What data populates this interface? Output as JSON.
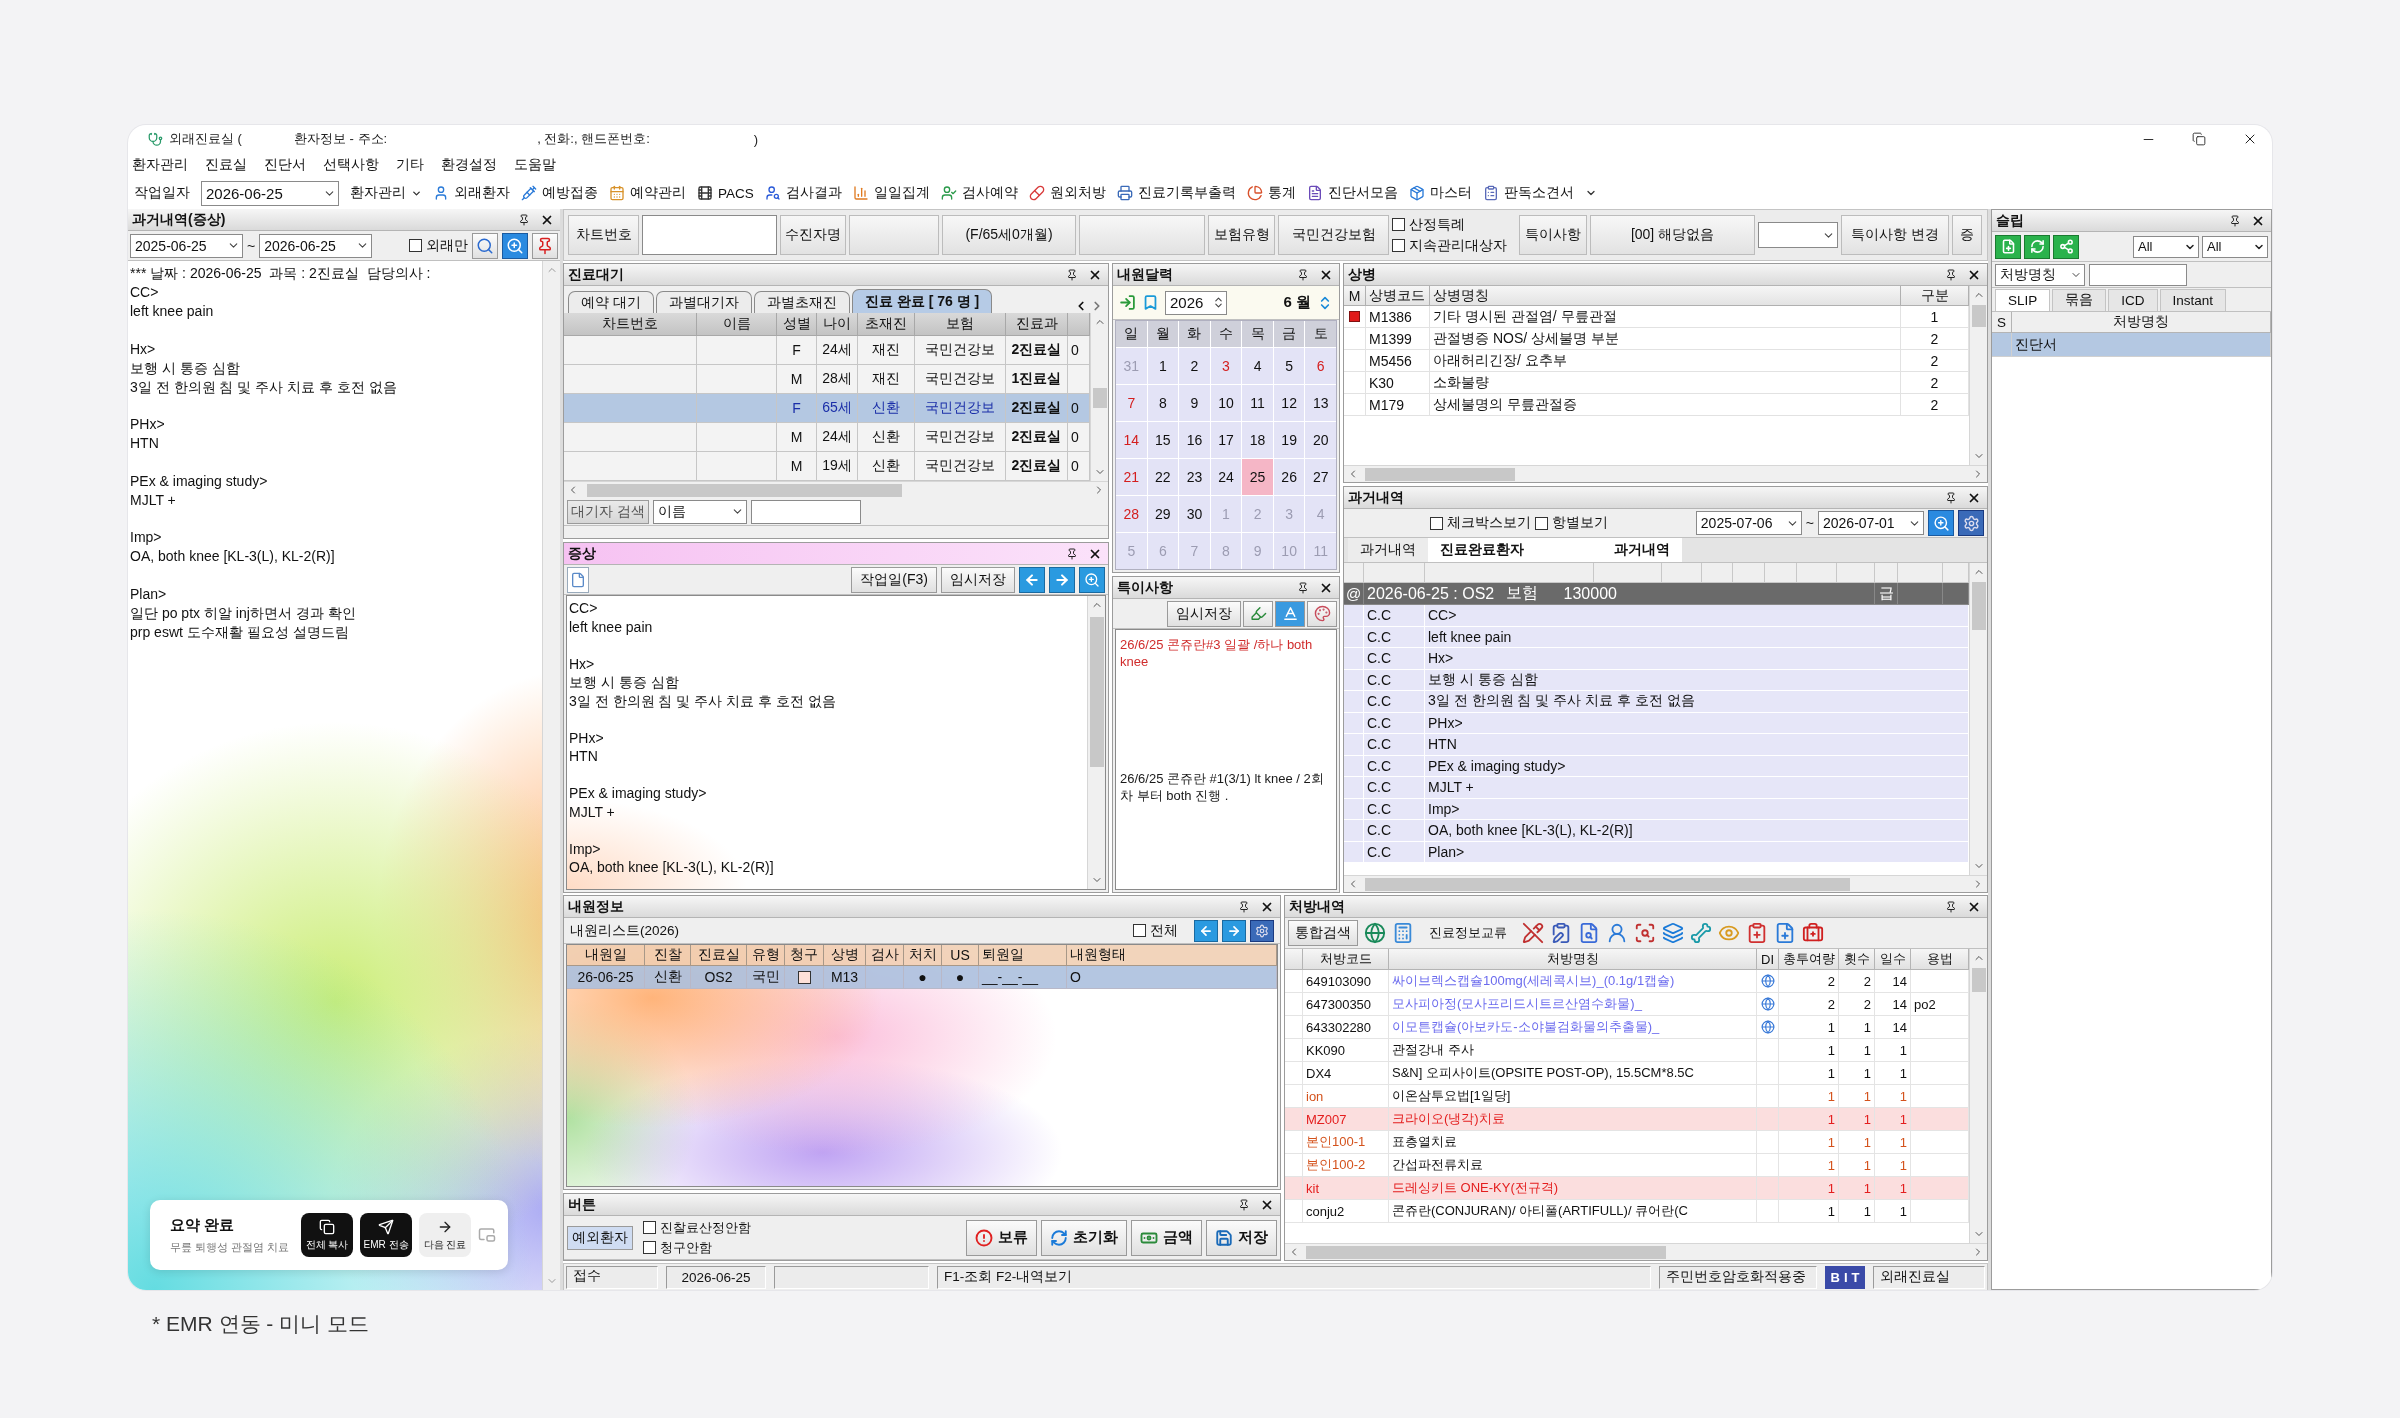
{
  "window": {
    "title_parts": [
      "외래진료실 (",
      "환자정보 - 주소:",
      ", 전화:, 핸드폰번호:",
      ")"
    ]
  },
  "menu": [
    "환자관리",
    "진료실",
    "진단서",
    "선택사항",
    "기타",
    "환경설정",
    "도움말"
  ],
  "toolbar": {
    "date_label": "작업일자",
    "date": "2026-06-25",
    "patient_menu": "환자관리",
    "buttons": [
      "외래환자",
      "예방접종",
      "예약관리",
      "PACS",
      "검사결과",
      "일일집계",
      "검사예약",
      "원외처방",
      "진료기록부출력",
      "통계",
      "진단서모음",
      "마스터",
      "판독소견서"
    ]
  },
  "history": {
    "title": "과거내역(증상)",
    "date_from": "2025-06-25",
    "separator": "~",
    "date_to": "2026-06-25",
    "outpatient_only": {
      "label": "외래만",
      "checked": false
    },
    "header_line": "*** 날짜 : 2026-06-25  과목 : 2진료실  담당의사 :",
    "blocks": [
      [
        "CC>",
        "left knee pain"
      ],
      [
        "Hx>",
        "보행 시 통증 심함",
        "3일 전 한의원 침 및 주사 치료 후 호전 없음"
      ],
      [
        "PHx>",
        "HTN"
      ],
      [
        "PEx & imaging study>",
        "MJLT +"
      ],
      [
        "Imp>",
        "OA, both knee [KL-3(L), KL-2(R)]"
      ],
      [
        "Plan>",
        "일단 po ptx 히알 inj하면서 경과 확인",
        "prp eswt 도수재활 필요성 설명드림"
      ]
    ]
  },
  "summary_card": {
    "title": "요약 완료",
    "subtitle": "무릎 퇴행성 관절염 치료",
    "actions": [
      {
        "label": "전체 복사",
        "kind": "dark"
      },
      {
        "label": "EMR 전송",
        "kind": "dark"
      },
      {
        "label": "다음 진료",
        "kind": "light"
      }
    ]
  },
  "patient_bar": {
    "chart_no_label": "차트번호",
    "name_label": "수진자명",
    "age": "(F/65세0개월)",
    "insurance_label": "보험유형",
    "insurance": "국민건강보험",
    "flags": [
      {
        "label": "산정특례",
        "checked": false
      },
      {
        "label": "지속관리대상자",
        "checked": false
      }
    ],
    "special_label": "특이사항",
    "special_value": "[00] 해당없음",
    "special_change": "특이사항 변경",
    "cut_button": "증"
  },
  "waiting": {
    "title": "진료대기",
    "tabs": [
      {
        "label": "예약 대기",
        "selected": false
      },
      {
        "label": "과별대기자",
        "selected": false
      },
      {
        "label": "과별초재진",
        "selected": false
      },
      {
        "label": "진료 완료 [ 76 명 ]",
        "selected": true
      }
    ],
    "columns": [
      "차트번호",
      "이름",
      "성별",
      "나이",
      "초재진",
      "보험",
      "진료과"
    ],
    "rows": [
      {
        "sex": "F",
        "age": "24세",
        "visit": "재진",
        "insurance": "국민건강보",
        "room": "2진료실",
        "column_8": "0",
        "selected": false
      },
      {
        "sex": "M",
        "age": "28세",
        "visit": "재진",
        "insurance": "국민건강보",
        "room": "1진료실",
        "selected": false
      },
      {
        "sex": "F",
        "age": "65세",
        "visit": "신환",
        "insurance": "국민건강보",
        "room": "2진료실",
        "column_8": "0",
        "selected": true
      },
      {
        "sex": "M",
        "age": "24세",
        "visit": "신환",
        "insurance": "국민건강보",
        "room": "2진료실",
        "column_8": "0",
        "selected": false
      },
      {
        "sex": "M",
        "age": "19세",
        "visit": "신환",
        "insurance": "국민건강보",
        "room": "2진료실",
        "column_8": "0",
        "selected": false
      }
    ],
    "search": {
      "label": "대기자 검색",
      "field": "이름"
    }
  },
  "symptoms": {
    "title": "증상",
    "buttons": [
      "작업일(F3)",
      "임시저장"
    ],
    "blocks": [
      [
        "CC>",
        "left knee pain"
      ],
      [
        "Hx>",
        "보행 시 통증 심함",
        "3일 전 한의원 침 및 주사 치료 후 호전 없음"
      ],
      [
        "PHx>",
        "HTN"
      ],
      [
        "PEx & imaging study>",
        "MJLT +"
      ],
      [
        "Imp>",
        "OA, both knee [KL-3(L), KL-2(R)]"
      ]
    ]
  },
  "calendar": {
    "title": "내원달력",
    "year": "2026",
    "month": "6 월",
    "weekdays": [
      "일",
      "월",
      "화",
      "수",
      "목",
      "금",
      "토"
    ],
    "weeks": [
      [
        {
          "day": "31",
          "in_month": false,
          "holiday": false,
          "selected": false
        },
        {
          "day": "1",
          "in_month": true,
          "holiday": false,
          "selected": false
        },
        {
          "day": "2",
          "in_month": true,
          "holiday": false,
          "selected": false
        },
        {
          "day": "3",
          "in_month": true,
          "holiday": true,
          "selected": false
        },
        {
          "day": "4",
          "in_month": true,
          "holiday": false,
          "selected": false
        },
        {
          "day": "5",
          "in_month": true,
          "holiday": false,
          "selected": false
        },
        {
          "day": "6",
          "in_month": true,
          "holiday": true,
          "selected": false
        }
      ],
      [
        {
          "day": "7",
          "in_month": true,
          "holiday": true,
          "selected": false
        },
        {
          "day": "8",
          "in_month": true,
          "holiday": false,
          "selected": false
        },
        {
          "day": "9",
          "in_month": true,
          "holiday": false,
          "selected": false
        },
        {
          "day": "10",
          "in_month": true,
          "holiday": false,
          "selected": false
        },
        {
          "day": "11",
          "in_month": true,
          "holiday": false,
          "selected": false
        },
        {
          "day": "12",
          "in_month": true,
          "holiday": false,
          "selected": false
        },
        {
          "day": "13",
          "in_month": true,
          "holiday": false,
          "selected": false
        }
      ],
      [
        {
          "day": "14",
          "in_month": true,
          "holiday": true,
          "selected": false
        },
        {
          "day": "15",
          "in_month": true,
          "holiday": false,
          "selected": false
        },
        {
          "day": "16",
          "in_month": true,
          "holiday": false,
          "selected": false
        },
        {
          "day": "17",
          "in_month": true,
          "holiday": false,
          "selected": false
        },
        {
          "day": "18",
          "in_month": true,
          "holiday": false,
          "selected": false
        },
        {
          "day": "19",
          "in_month": true,
          "holiday": false,
          "selected": false
        },
        {
          "day": "20",
          "in_month": true,
          "holiday": false,
          "selected": false
        }
      ],
      [
        {
          "day": "21",
          "in_month": true,
          "holiday": true,
          "selected": false
        },
        {
          "day": "22",
          "in_month": true,
          "holiday": false,
          "selected": false
        },
        {
          "day": "23",
          "in_month": true,
          "holiday": false,
          "selected": false
        },
        {
          "day": "24",
          "in_month": true,
          "holiday": false,
          "selected": false
        },
        {
          "day": "25",
          "in_month": true,
          "holiday": false,
          "selected": true
        },
        {
          "day": "26",
          "in_month": true,
          "holiday": false,
          "selected": false
        },
        {
          "day": "27",
          "in_month": true,
          "holiday": false,
          "selected": false
        }
      ],
      [
        {
          "day": "28",
          "in_month": true,
          "holiday": true,
          "selected": false
        },
        {
          "day": "29",
          "in_month": true,
          "holiday": false,
          "selected": false
        },
        {
          "day": "30",
          "in_month": true,
          "holiday": false,
          "selected": false
        },
        {
          "day": "1",
          "in_month": false,
          "holiday": false,
          "selected": false
        },
        {
          "day": "2",
          "in_month": false,
          "holiday": false,
          "selected": false
        },
        {
          "day": "3",
          "in_month": false,
          "holiday": false,
          "selected": false
        },
        {
          "day": "4",
          "in_month": false,
          "holiday": false,
          "selected": false
        }
      ],
      [
        {
          "day": "5",
          "in_month": false,
          "holiday": false,
          "selected": false
        },
        {
          "day": "6",
          "in_month": false,
          "holiday": false,
          "selected": false
        },
        {
          "day": "7",
          "in_month": false,
          "holiday": false,
          "selected": false
        },
        {
          "day": "8",
          "in_month": false,
          "holiday": false,
          "selected": false
        },
        {
          "day": "9",
          "in_month": false,
          "holiday": false,
          "selected": false
        },
        {
          "day": "10",
          "in_month": false,
          "holiday": false,
          "selected": false
        },
        {
          "day": "11",
          "in_month": false,
          "holiday": false,
          "selected": false
        }
      ]
    ]
  },
  "special_notes": {
    "title": "특이사항",
    "save": "임시저장",
    "notes": [
      {
        "text": "26/6/25 콘쥬란#3 일괄 /하나  both knee",
        "color": "#d02c2c"
      },
      {
        "text": "26/6/25 콘쥬란 #1(3/1) lt knee / 2회차 부터 both 진행 .",
        "color": "#1a1a1a"
      }
    ]
  },
  "diagnosis": {
    "title": "상병",
    "columns": [
      "M",
      "상병코드",
      "상병명칭",
      "구분"
    ],
    "rows": [
      {
        "code": "M1386",
        "name": "기타 명시된 관절염/ 무릎관절",
        "type": "1",
        "main": true
      },
      {
        "code": "M1399",
        "name": "관절병증 NOS/ 상세불명 부분",
        "type": "2",
        "main": false
      },
      {
        "code": "M5456",
        "name": "아래허리긴장/ 요추부",
        "type": "2",
        "main": false
      },
      {
        "code": "K30",
        "name": "소화불량",
        "type": "2",
        "main": false
      },
      {
        "code": "M179",
        "name": "상세불명의 무릎관절증",
        "type": "2",
        "main": false
      }
    ]
  },
  "past": {
    "title": "과거내역",
    "options": [
      {
        "label": "체크박스보기",
        "checked": false
      },
      {
        "label": "항별보기",
        "checked": false
      }
    ],
    "date_from": "2025-07-06",
    "separator": "~",
    "date_to": "2026-07-01",
    "tabs": [
      {
        "labels": [
          "과거내역"
        ],
        "selected": false
      },
      {
        "labels": [
          "진료완료환자",
          "과거내역"
        ],
        "selected": true
      }
    ],
    "group": {
      "marker": "@",
      "date": "2026-06-25 : OS2",
      "insurance": "보험",
      "amount": "130000",
      "grade": "급"
    },
    "rows": [
      {
        "type": "C.C",
        "text": "CC>"
      },
      {
        "type": "C.C",
        "text": "left knee pain"
      },
      {
        "type": "C.C",
        "text": "Hx>"
      },
      {
        "type": "C.C",
        "text": "보행 시 통증 심함"
      },
      {
        "type": "C.C",
        "text": "3일 전 한의원 침 및 주사 치료 후 호전 없음"
      },
      {
        "type": "C.C",
        "text": "PHx>"
      },
      {
        "type": "C.C",
        "text": "HTN"
      },
      {
        "type": "C.C",
        "text": "PEx & imaging study>"
      },
      {
        "type": "C.C",
        "text": "MJLT +"
      },
      {
        "type": "C.C",
        "text": "Imp>"
      },
      {
        "type": "C.C",
        "text": "OA, both knee [KL-3(L), KL-2(R)]"
      },
      {
        "type": "C.C",
        "text": "Plan>"
      }
    ]
  },
  "visits": {
    "title": "내원정보",
    "list_title": "내원리스트(2026)",
    "all": {
      "label": "전체",
      "checked": false
    },
    "columns": [
      "내원일",
      "진찰",
      "진료실",
      "유형",
      "청구",
      "상병",
      "검사",
      "처치",
      "US",
      "퇴원일",
      "내원형태"
    ],
    "rows": [
      {
        "date": "26-06-25",
        "exam": "신환",
        "room": "OS2",
        "type": "국민",
        "claim": false,
        "diagnosis": "M13",
        "treatment": "●",
        "us": "●",
        "discharge": "__-__-__",
        "visit_form": "O",
        "selected": true
      }
    ]
  },
  "actions": {
    "title": "버튼",
    "exception": "예외환자",
    "options": [
      {
        "label": "진찰료산정안함",
        "checked": false
      },
      {
        "label": "청구안함",
        "checked": false
      }
    ],
    "buttons": [
      "보류",
      "초기화",
      "금액",
      "저장"
    ]
  },
  "prescriptions": {
    "title": "처방내역",
    "search": "통합검색",
    "exchange": "진료정보교류",
    "columns": [
      "처방코드",
      "처방명칭",
      "DI",
      "총투여량",
      "횟수",
      "일수",
      "용법"
    ],
    "rows": [
      {
        "kind": "drug",
        "code": "649103090",
        "name": "싸이브렉스캡슐100mg(세레콕시브)_(0.1g/1캡슐)",
        "total": "2",
        "times": "2",
        "days": "14"
      },
      {
        "kind": "drug",
        "code": "647300350",
        "name": "모사피아정(모사프리드시트르산염수화물)_",
        "total": "2",
        "times": "2",
        "days": "14",
        "usage": "po2"
      },
      {
        "kind": "drug",
        "code": "643302280",
        "name": "이모튼캡슐(아보카도-소야불검화물의추출물)_",
        "total": "1",
        "times": "1",
        "days": "14"
      },
      {
        "kind": "normal",
        "code": "KK090",
        "name": "관절강내 주사",
        "total": "1",
        "times": "1",
        "days": "1"
      },
      {
        "kind": "normal",
        "code": "DX4",
        "name": "S&N] 오피사이트(OPSITE POST-OP), 15.5CM*8.5C",
        "total": "1",
        "times": "1",
        "days": "1"
      },
      {
        "kind": "self_pay",
        "code": "ion",
        "name": "이온삼투요법[1일당]",
        "total": "1",
        "times": "1",
        "days": "1"
      },
      {
        "kind": "highlight",
        "code": "MZ007",
        "name": "크라이오(냉각)치료",
        "total": "1",
        "times": "1",
        "days": "1"
      },
      {
        "kind": "self_pay",
        "code": "본인100-1",
        "name": "표층열치료",
        "total": "1",
        "times": "1",
        "days": "1"
      },
      {
        "kind": "self_pay",
        "code": "본인100-2",
        "name": "간섭파전류치료",
        "total": "1",
        "times": "1",
        "days": "1"
      },
      {
        "kind": "highlight",
        "code": "kit",
        "name": "드레싱키트 ONE-KY(전규격)",
        "total": "1",
        "times": "1",
        "days": "1"
      },
      {
        "kind": "normal",
        "code": "conju2",
        "name": "콘쥬란(CONJURAN)/ 아티풀(ARTIFULL)/ 큐어란(C",
        "total": "1",
        "times": "1",
        "days": "1"
      }
    ]
  },
  "status_bar": {
    "reception": "접수",
    "date": "2026-06-25",
    "hint": "F1-조회 F2-내역보기",
    "encryption": "주민번호암호화적용중",
    "logo": "BIT",
    "location": "외래진료실"
  },
  "slip": {
    "title": "슬립",
    "filters": [
      "All",
      "All"
    ],
    "search_field": "처방명칭",
    "tabs": [
      {
        "label": "SLIP",
        "selected": true
      },
      {
        "label": "묶음",
        "selected": false
      },
      {
        "label": "ICD",
        "selected": false
      },
      {
        "label": "Instant",
        "selected": false
      }
    ],
    "columns": [
      "S",
      "처방명칭"
    ],
    "rows": [
      {
        "name": "진단서",
        "selected": true
      }
    ]
  },
  "caption": "* EMR 연동 - 미니 모드"
}
